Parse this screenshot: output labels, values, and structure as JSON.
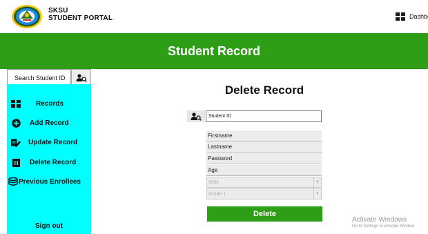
{
  "header": {
    "brand_line1": "SKSU",
    "brand_line2": "STUDENT PORTAL",
    "dashboard_label": "Dashboard"
  },
  "banner": {
    "title": "Student Record"
  },
  "search": {
    "placeholder": "Search Student ID"
  },
  "sidebar": {
    "items": [
      {
        "label": "Records",
        "icon": "records-grid-icon"
      },
      {
        "label": "Add Record",
        "icon": "plus-circle-icon"
      },
      {
        "label": "Update Record",
        "icon": "pencil-edit-icon"
      },
      {
        "label": "Delete Record",
        "icon": "trash-icon"
      },
      {
        "label": "Previous Enrollees",
        "icon": "database-icon"
      }
    ],
    "signout_label": "Sign out"
  },
  "form": {
    "title": "Delete Record",
    "student_id_placeholder": "Student ID",
    "firstname": "Firstname",
    "lastname": "Lastname",
    "password": "Password",
    "age": "Age",
    "gender_selected": "Male",
    "grade_selected": "Grade 1",
    "delete_label": "Delete"
  },
  "watermark": {
    "line1": "Activate Windows",
    "line2": "Go to Settings to activate Window"
  },
  "colors": {
    "green": "#2e9e16",
    "sidebar": "#00ffff"
  }
}
